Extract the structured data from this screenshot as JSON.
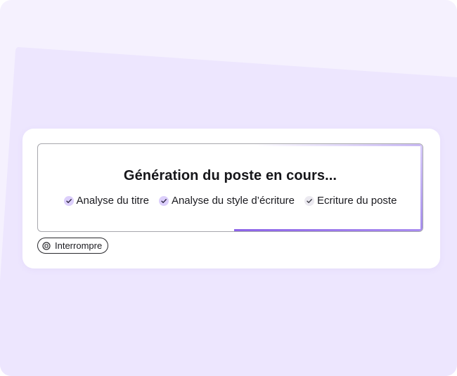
{
  "colors": {
    "accent": "#8c63e8",
    "background": "#f5f1fe",
    "card": "#ffffff",
    "check_done": "#dccffb"
  },
  "progress": {
    "title": "Génération du poste en cours...",
    "fill_fraction": 0.49,
    "steps": [
      {
        "label": "Analyse du titre",
        "status": "done",
        "icon": "check-icon"
      },
      {
        "label": "Analyse du style d’écriture",
        "status": "done",
        "icon": "check-icon"
      },
      {
        "label": "Ecriture du poste",
        "status": "pending",
        "icon": "check-icon"
      }
    ]
  },
  "actions": {
    "stop_label": "Interrompre",
    "stop_icon": "stop-icon"
  }
}
